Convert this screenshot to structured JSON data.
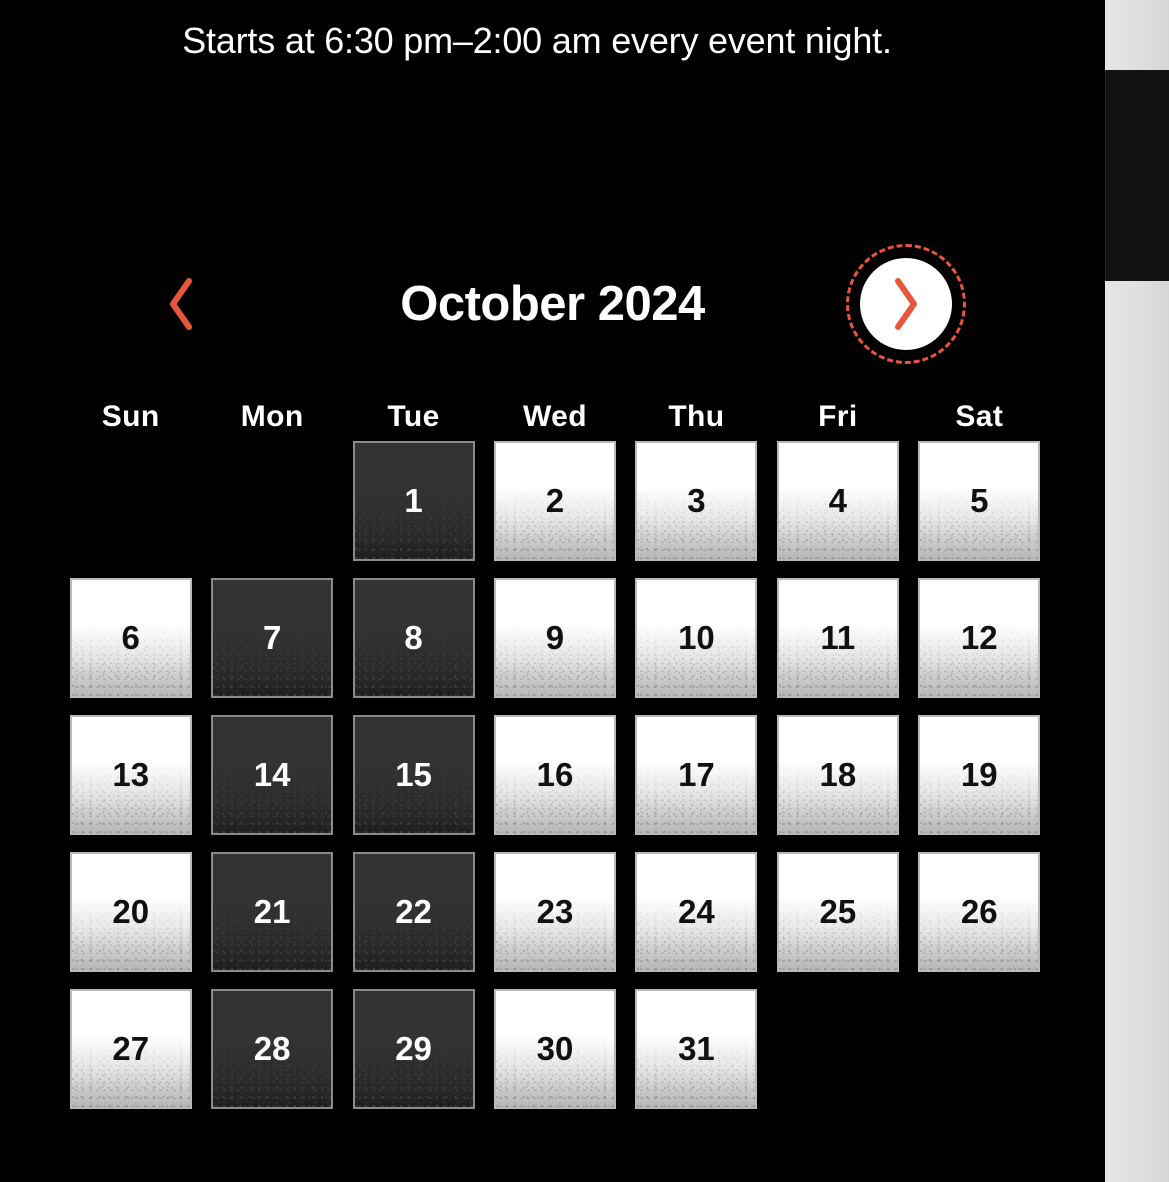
{
  "note": "Starts at 6:30 pm–2:00 am every event night.",
  "colors": {
    "accent": "#e8573c",
    "widget_background": "#000000",
    "page_background": "#e3e3e3",
    "available_cell": "#ffffff",
    "disabled_cell": "#333333",
    "cell_border": "#8c8c8c"
  },
  "nav": {
    "prev_label": "‹",
    "prev_icon": "chevron-left-icon",
    "next_label": "›",
    "next_icon": "chevron-right-icon",
    "next_focused": true
  },
  "calendar": {
    "month_title": "October 2024",
    "weekdays": [
      "Sun",
      "Mon",
      "Tue",
      "Wed",
      "Thu",
      "Fri",
      "Sat"
    ],
    "leading_blanks": 2,
    "days": [
      {
        "n": "1",
        "weekday": "Tue",
        "state": "disabled"
      },
      {
        "n": "2",
        "weekday": "Wed",
        "state": "available"
      },
      {
        "n": "3",
        "weekday": "Thu",
        "state": "available"
      },
      {
        "n": "4",
        "weekday": "Fri",
        "state": "available"
      },
      {
        "n": "5",
        "weekday": "Sat",
        "state": "available"
      },
      {
        "n": "6",
        "weekday": "Sun",
        "state": "available"
      },
      {
        "n": "7",
        "weekday": "Mon",
        "state": "disabled"
      },
      {
        "n": "8",
        "weekday": "Tue",
        "state": "disabled"
      },
      {
        "n": "9",
        "weekday": "Wed",
        "state": "available"
      },
      {
        "n": "10",
        "weekday": "Thu",
        "state": "available"
      },
      {
        "n": "11",
        "weekday": "Fri",
        "state": "available"
      },
      {
        "n": "12",
        "weekday": "Sat",
        "state": "available"
      },
      {
        "n": "13",
        "weekday": "Sun",
        "state": "available"
      },
      {
        "n": "14",
        "weekday": "Mon",
        "state": "disabled"
      },
      {
        "n": "15",
        "weekday": "Tue",
        "state": "disabled"
      },
      {
        "n": "16",
        "weekday": "Wed",
        "state": "available"
      },
      {
        "n": "17",
        "weekday": "Thu",
        "state": "available"
      },
      {
        "n": "18",
        "weekday": "Fri",
        "state": "available"
      },
      {
        "n": "19",
        "weekday": "Sat",
        "state": "available"
      },
      {
        "n": "20",
        "weekday": "Sun",
        "state": "available"
      },
      {
        "n": "21",
        "weekday": "Mon",
        "state": "disabled"
      },
      {
        "n": "22",
        "weekday": "Tue",
        "state": "disabled"
      },
      {
        "n": "23",
        "weekday": "Wed",
        "state": "available"
      },
      {
        "n": "24",
        "weekday": "Thu",
        "state": "available"
      },
      {
        "n": "25",
        "weekday": "Fri",
        "state": "available"
      },
      {
        "n": "26",
        "weekday": "Sat",
        "state": "available"
      },
      {
        "n": "27",
        "weekday": "Sun",
        "state": "available"
      },
      {
        "n": "28",
        "weekday": "Mon",
        "state": "disabled"
      },
      {
        "n": "29",
        "weekday": "Tue",
        "state": "disabled"
      },
      {
        "n": "30",
        "weekday": "Wed",
        "state": "available"
      },
      {
        "n": "31",
        "weekday": "Thu",
        "state": "available"
      }
    ]
  }
}
